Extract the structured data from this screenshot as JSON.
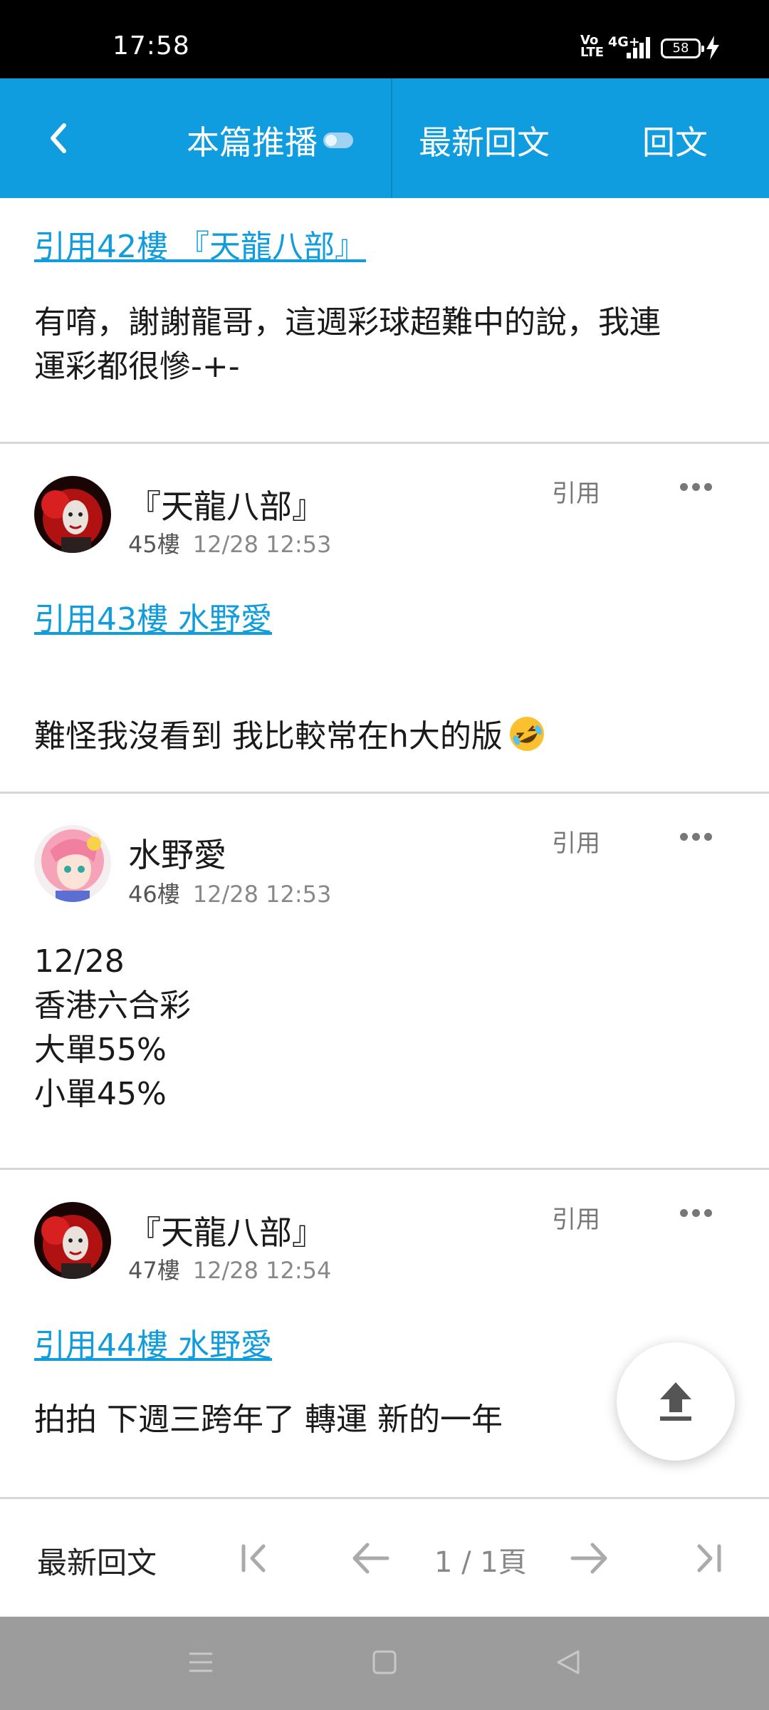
{
  "status": {
    "time": "17:58",
    "net_top": "Vo",
    "net_bottom": "LTE",
    "signal": "4G+",
    "battery": "58"
  },
  "topbar": {
    "push_label": "本篇推播",
    "latest_label": "最新回文",
    "reply_label": "回文"
  },
  "posts": [
    {
      "quote_link": "引用42樓 『天龍八部』",
      "text": "有唷，謝謝龍哥，這週彩球超難中的說，我連\n運彩都很慘-+-"
    },
    {
      "author": "『天龍八部』",
      "floor": "45樓",
      "time": "12/28 12:53",
      "quote_label": "引用",
      "quote_link": "引用43樓 水野愛",
      "text": "難怪我沒看到 我比較常在h大的版"
    },
    {
      "author": "水野愛",
      "floor": "46樓",
      "time": "12/28 12:53",
      "quote_label": "引用",
      "text": "12/28\n香港六合彩\n大單55%\n小單45%"
    },
    {
      "author": "『天龍八部』",
      "floor": "47樓",
      "time": "12/28 12:54",
      "quote_label": "引用",
      "quote_link": "引用44樓 水野愛",
      "text": "拍拍 下週三跨年了 轉運 新的一年"
    }
  ],
  "pager": {
    "latest_label": "最新回文",
    "page_info": "1 / 1頁"
  },
  "icons": {
    "back": "chevron-left-icon",
    "more": "more-dots-icon",
    "top": "upload-arrow-icon",
    "first": "first-page-icon",
    "prev": "arrow-left-icon",
    "next": "arrow-right-icon",
    "last": "last-page-icon",
    "emoji": "rofl-emoji-icon"
  },
  "colors": {
    "accent": "#0f9ddf",
    "link": "#119cdc",
    "navbar": "#9c9c9c"
  }
}
